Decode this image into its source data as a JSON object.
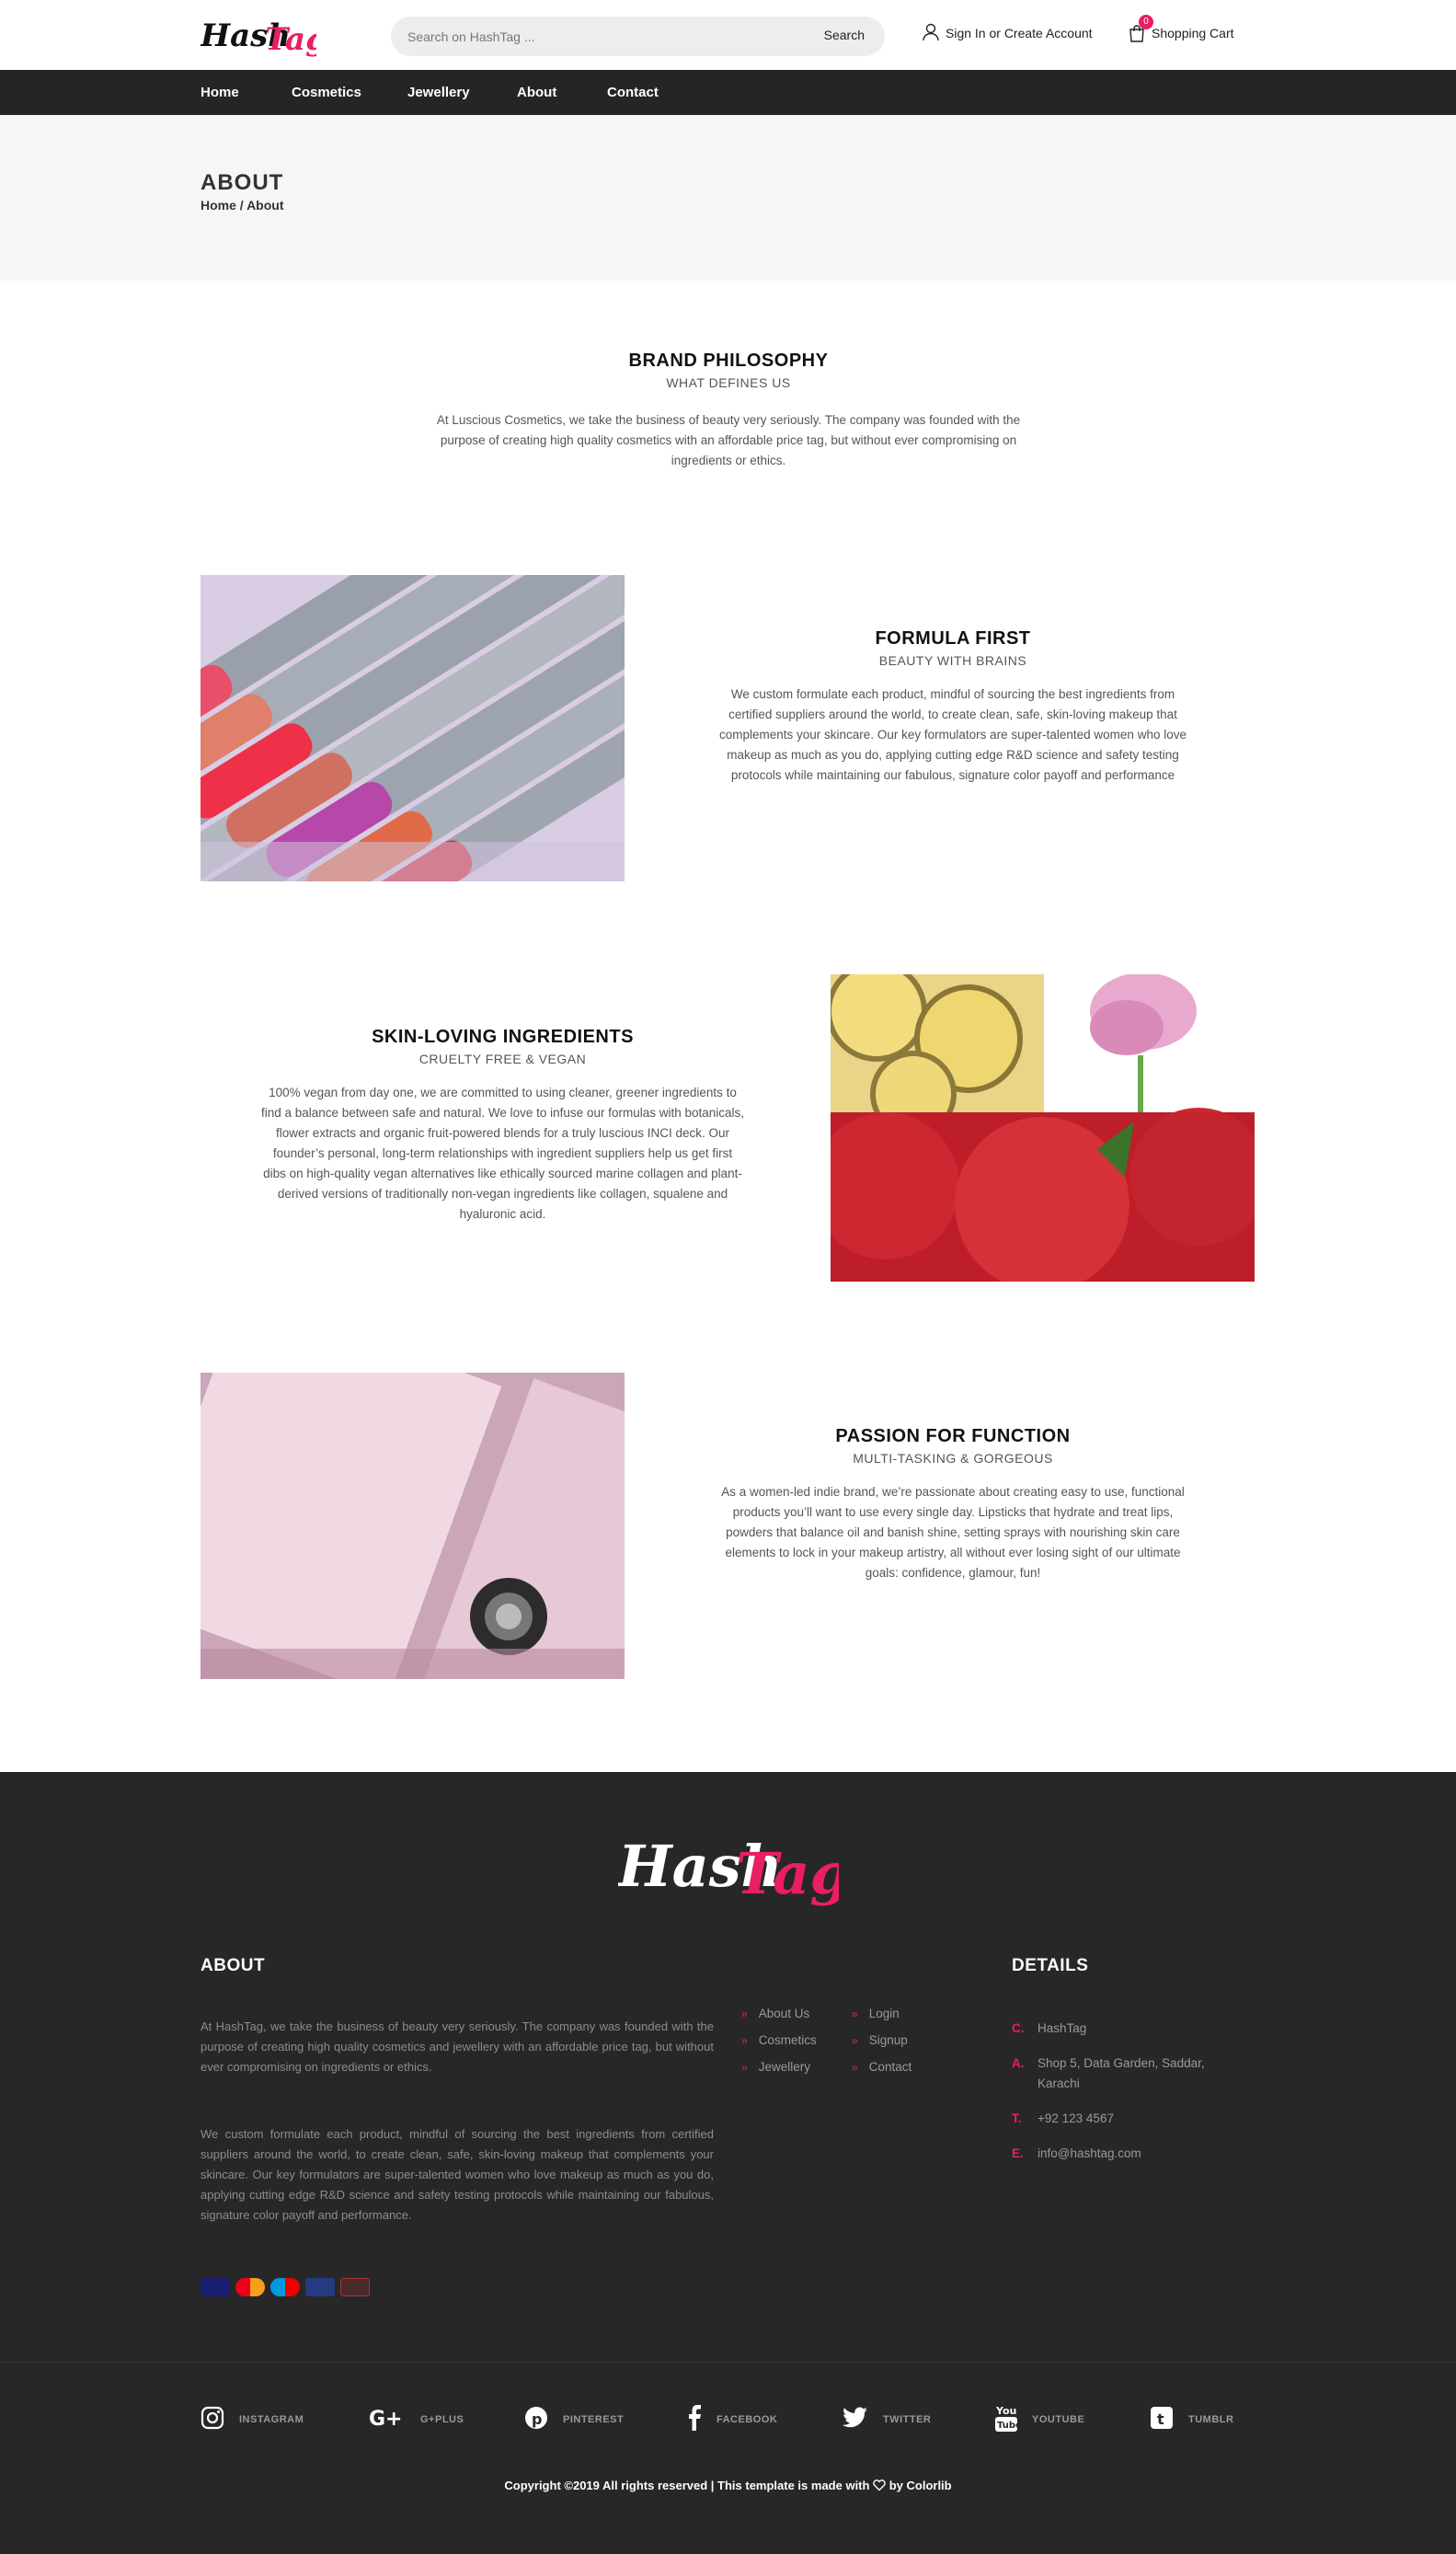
{
  "header": {
    "logo": {
      "part1": "Hash",
      "part2": "Tag"
    },
    "search": {
      "placeholder": "Search on HashTag ...",
      "button": "Search"
    },
    "account": "Sign In or Create Account",
    "cart": {
      "label": "Shopping Cart",
      "count": "0"
    }
  },
  "nav": {
    "items": [
      "Home",
      "Cosmetics",
      "Jewellery",
      "About",
      "Contact"
    ]
  },
  "page_header": {
    "title": "ABOUT",
    "crumbs": [
      "Home",
      "/",
      "About"
    ]
  },
  "sections": {
    "philosophy": {
      "title": "BRAND PHILOSOPHY",
      "subtitle": "WHAT DEFINES US",
      "text": "At Luscious Cosmetics, we take the business of beauty very seriously. The company was founded with the purpose of creating high quality cosmetics with an affordable price tag, but without ever compromising on ingredients or ethics."
    },
    "formula": {
      "title": "FORMULA FIRST",
      "subtitle": "BEAUTY WITH BRAINS",
      "text": "We custom formulate each product, mindful of sourcing the best ingredients from certified suppliers around the world, to create clean, safe, skin-loving makeup that complements your skincare. Our key formulators are super-talented women who love makeup as much as you do, applying cutting edge R&D science and safety testing protocols while maintaining our fabulous, signature color payoff and performance"
    },
    "ingredients": {
      "title": "SKIN-LOVING INGREDIENTS",
      "subtitle": "CRUELTY FREE & VEGAN",
      "text": "100% vegan from day one, we are committed to using cleaner, greener ingredients to find a balance between safe and natural. We love to infuse our formulas with botanicals, flower extracts and organic fruit-powered blends for a truly luscious INCI deck. Our founder’s personal, long-term relationships with ingredient suppliers help us get first dibs on high-quality vegan alternatives like ethically sourced marine collagen and plant-derived versions of traditionally non-vegan ingredients like collagen, squalene and hyaluronic acid."
    },
    "passion": {
      "title": "PASSION FOR FUNCTION",
      "subtitle": "MULTI-TASKING & GORGEOUS",
      "text": "As a women-led indie brand, we’re passionate about creating easy to use, functional products you’ll want to use every single day. Lipsticks that hydrate and treat lips, powders that balance oil and banish shine, setting sprays with nourishing skin care elements to lock in your makeup artistry, all without ever losing sight of our ultimate goals: confidence, glamour, fun!"
    }
  },
  "footer": {
    "about_heading": "ABOUT",
    "about_p1": "At HashTag, we take the business of beauty very seriously. The company was founded with the purpose of creating high quality cosmetics and jewellery with an affordable price tag, but without ever compromising on ingredients or ethics.",
    "about_p2": "We custom formulate each product, mindful of sourcing the best ingredients from certified suppliers around the world, to create clean, safe, skin-loving makeup that complements your skincare. Our key formulators are super-talented women who love makeup as much as you do, applying cutting edge R&D science and safety testing protocols while maintaining our fabulous, signature color payoff and performance.",
    "links_col1": [
      "About Us",
      "Cosmetics",
      "Jewellery"
    ],
    "links_col2": [
      "Login",
      "Signup",
      "Contact"
    ],
    "details_heading": "DETAILS",
    "details": [
      {
        "key": "C.",
        "value": "HashTag"
      },
      {
        "key": "A.",
        "value": "Shop 5, Data Garden, Saddar, Karachi"
      },
      {
        "key": "T.",
        "value": "+92 123 4567"
      },
      {
        "key": "E.",
        "value": "info@hashtag.com"
      }
    ],
    "payments": [
      "visa",
      "mastercard",
      "maestro",
      "paypal",
      "other"
    ],
    "social": [
      {
        "icon": "instagram-icon",
        "label": "INSTAGRAM"
      },
      {
        "icon": "googleplus-icon",
        "label": "G+PLUS"
      },
      {
        "icon": "pinterest-icon",
        "label": "PINTEREST"
      },
      {
        "icon": "facebook-icon",
        "label": "FACEBOOK"
      },
      {
        "icon": "twitter-icon",
        "label": "TWITTER"
      },
      {
        "icon": "youtube-icon",
        "label": "YOUTUBE"
      },
      {
        "icon": "tumblr-icon",
        "label": "TUMBLR"
      }
    ],
    "copyright_left": "Copyright ©2019 All rights reserved | This template is made with",
    "copyright_right": "by Colorlib"
  },
  "colors": {
    "accent": "#e91e63",
    "nav_bg": "#252525",
    "footer_bg": "#272727",
    "page_head_bg": "#f6f6f6"
  }
}
